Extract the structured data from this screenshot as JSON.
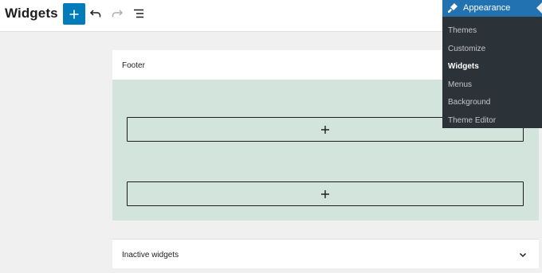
{
  "header": {
    "title": "Widgets",
    "add_icon": "plus-icon",
    "undo_icon": "undo-icon",
    "redo_icon": "redo-icon",
    "list_view_icon": "list-view-icon"
  },
  "footer": {
    "label": "Footer",
    "appender_icon": "plus-icon",
    "background_color": "#d3e4dd"
  },
  "inactive_widgets": {
    "label": "Inactive widgets",
    "toggle_icon": "chevron-down-icon"
  },
  "admin_menu": {
    "section_label": "Appearance",
    "section_icon": "paintbrush-icon",
    "items": [
      {
        "label": "Themes",
        "current": false
      },
      {
        "label": "Customize",
        "current": false
      },
      {
        "label": "Widgets",
        "current": true
      },
      {
        "label": "Menus",
        "current": false
      },
      {
        "label": "Background",
        "current": false
      },
      {
        "label": "Theme Editor",
        "current": false
      }
    ]
  },
  "colors": {
    "accent": "#007cba",
    "admin_accent": "#2271b1",
    "admin_bg": "#2c3338"
  }
}
